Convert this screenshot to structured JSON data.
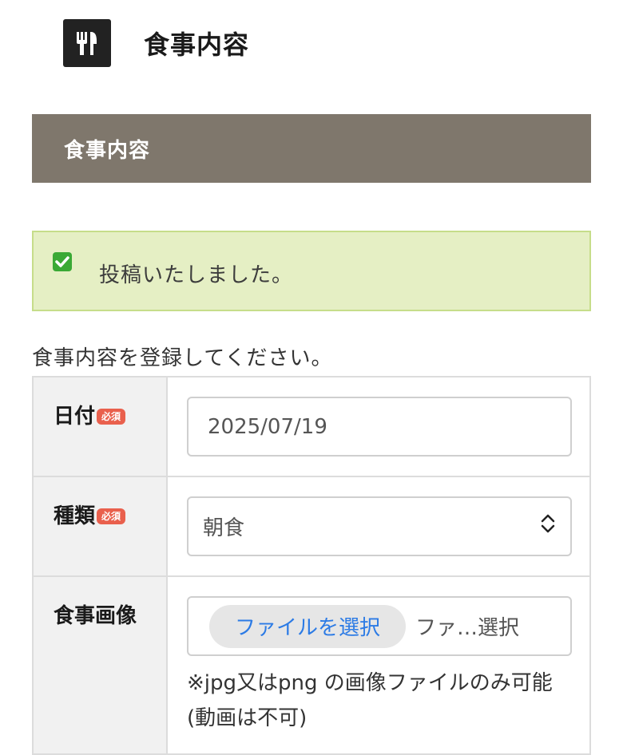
{
  "header": {
    "title": "食事内容",
    "icon": "utensils-icon"
  },
  "section": {
    "title": "食事内容"
  },
  "alert": {
    "message": "投稿いたしました。",
    "icon": "checkbox-checked-icon",
    "bg_color": "#e5efc4",
    "border_color": "#c6dd8a"
  },
  "form": {
    "instructions": "食事内容を登録してください。",
    "required_label": "必須",
    "date": {
      "label": "日付",
      "value": "2025/07/19"
    },
    "type": {
      "label": "種類",
      "value": "朝食"
    },
    "image": {
      "label": "食事画像",
      "button_label": "ファイルを選択",
      "status": "ファ…選択",
      "note": "※jpg又はpng の画像ファイルのみ可能(動画は不可)"
    }
  },
  "colors": {
    "section_bar": "#7f776c",
    "required_badge": "#e9604d",
    "file_button_text": "#2c7be5"
  }
}
